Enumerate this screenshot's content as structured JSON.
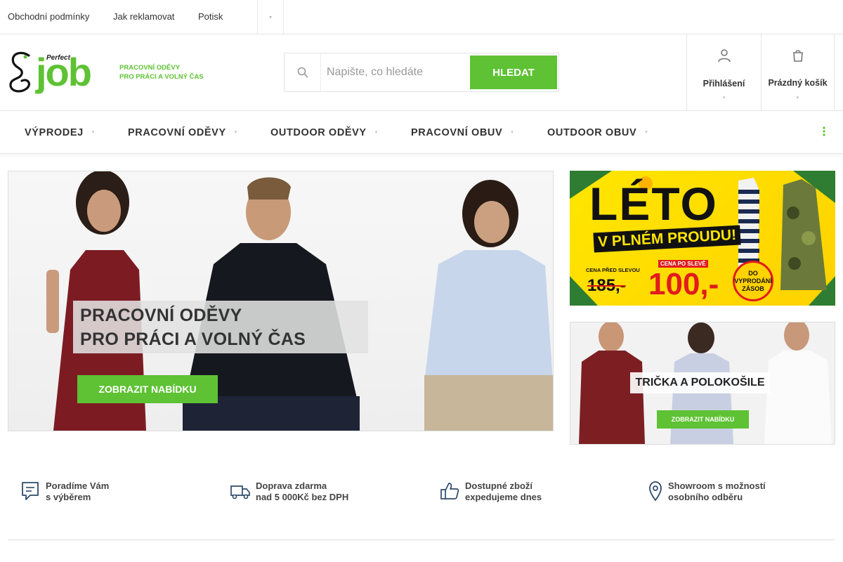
{
  "topbar": {
    "links": [
      "Obchodní podmínky",
      "Jak reklamovat",
      "Potisk"
    ],
    "more_icon": "chevron-down-icon"
  },
  "brand": {
    "perfect": "Perfect",
    "job": "job",
    "tagline_1": "PRACOVNÍ ODĚVY",
    "tagline_2": "PRO PRÁCI A VOLNÝ ČAS",
    "accent_color": "#5ec234"
  },
  "search": {
    "placeholder": "Napište, co hledáte",
    "value": "",
    "button_label": "HLEDAT",
    "icon": "search-icon"
  },
  "account": {
    "login_label": "Přihlášení",
    "cart_label": "Prázdný košík"
  },
  "nav": {
    "items": [
      "VÝPRODEJ",
      "PRACOVNÍ ODĚVY",
      "OUTDOOR ODĚVY",
      "PRACOVNÍ OBUV",
      "OUTDOOR OBUV"
    ],
    "more_icon": "more-vertical-icon"
  },
  "hero": {
    "title_1": "PRACOVNÍ ODĚVY",
    "title_2": "PRO PRÁCI A VOLNÝ ČAS",
    "button_label": "ZOBRAZIT NABÍDKU"
  },
  "promo_summer": {
    "title": "LÉTO",
    "subtitle": "V PLNÉM PROUDU!",
    "price_before_label": "CENA PŘED SLEVOU",
    "price_before": "185,-",
    "price_after_label": "CENA PO SLEVĚ",
    "price_after": "100,-",
    "stamp_1": "DO",
    "stamp_2": "VYPRODÁNÍ",
    "stamp_3": "ZÁSOB"
  },
  "promo_tshirts": {
    "title": "TRIČKA A POLOKOŠILE",
    "button_label": "ZOBRAZIT NABÍDKU"
  },
  "benefits": [
    {
      "line1": "Poradíme Vám",
      "line2": "s výběrem",
      "icon": "chat-icon"
    },
    {
      "line1": "Doprava zdarma",
      "line2": "nad 5 000Kč bez DPH",
      "icon": "truck-icon"
    },
    {
      "line1": "Dostupné zboží",
      "line2": "expedujeme dnes",
      "icon": "thumbs-up-icon"
    },
    {
      "line1": "Showroom s možností",
      "line2": "osobního odběru",
      "icon": "location-pin-icon"
    }
  ]
}
